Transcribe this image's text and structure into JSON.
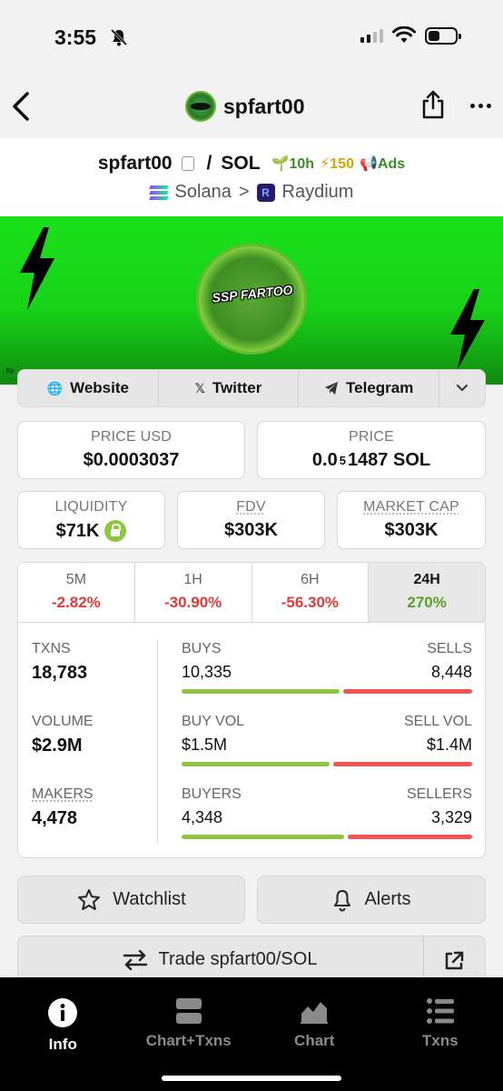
{
  "status_bar": {
    "time": "3:55"
  },
  "nav": {
    "title": "spfart00"
  },
  "pair": {
    "base": "spfart00",
    "slash": "/",
    "quote": "SOL",
    "age": "10h",
    "boosts": "150",
    "ads": "Ads",
    "chain": "Solana",
    "separator": ">",
    "dex": "Raydium"
  },
  "banner": {
    "logo_text": "SSP FARTOO",
    "by_text": "by"
  },
  "links": {
    "website": "Website",
    "twitter": "Twitter",
    "telegram": "Telegram"
  },
  "stats": {
    "price_usd_label": "PRICE USD",
    "price_usd": "$0.0003037",
    "price_label": "PRICE",
    "price_prefix": "0.0",
    "price_subscript": "5",
    "price_suffix": "1487 SOL",
    "liquidity_label": "LIQUIDITY",
    "liquidity": "$71K",
    "fdv_label": "FDV",
    "fdv": "$303K",
    "mcap_label": "MARKET CAP",
    "mcap": "$303K"
  },
  "timeframes": [
    {
      "label": "5M",
      "value": "-2.82%",
      "sign": "neg"
    },
    {
      "label": "1H",
      "value": "-30.90%",
      "sign": "neg"
    },
    {
      "label": "6H",
      "value": "-56.30%",
      "sign": "neg"
    },
    {
      "label": "24H",
      "value": "270%",
      "sign": "pos"
    }
  ],
  "activity": {
    "txns_label": "TXNS",
    "txns": "18,783",
    "volume_label": "VOLUME",
    "volume": "$2.9M",
    "makers_label": "MAKERS",
    "makers": "4,478",
    "buys_label": "BUYS",
    "buys": "10,335",
    "sells_label": "SELLS",
    "sells": "8,448",
    "buy_vol_label": "BUY VOL",
    "buy_vol": "$1.5M",
    "sell_vol_label": "SELL VOL",
    "sell_vol": "$1.4M",
    "buyers_label": "BUYERS",
    "buyers": "4,348",
    "sellers_label": "SELLERS",
    "sellers": "3,329",
    "buys_ratio": 0.55,
    "vol_ratio": 0.517,
    "buyers_ratio": 0.566
  },
  "actions": {
    "watchlist": "Watchlist",
    "alerts": "Alerts",
    "trade": "Trade spfart00/SOL"
  },
  "tabs": [
    {
      "label": "Info",
      "icon": "info-icon"
    },
    {
      "label": "Chart+Txns",
      "icon": "chart-txns-icon"
    },
    {
      "label": "Chart",
      "icon": "chart-icon"
    },
    {
      "label": "Txns",
      "icon": "txns-icon"
    }
  ],
  "colors": {
    "banner_green": "#1ae01a",
    "positive": "#5a9e2a",
    "negative": "#e03a3a",
    "buy_bar": "#8dc63f",
    "sell_bar": "#f05454"
  }
}
